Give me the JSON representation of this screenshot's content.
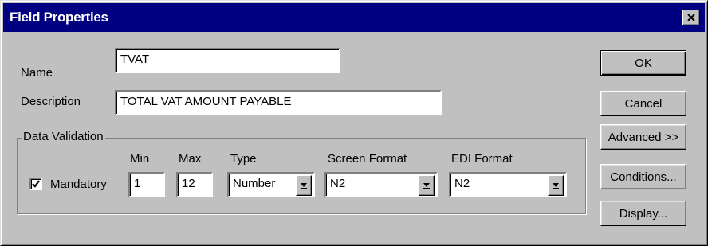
{
  "window": {
    "title": "Field Properties",
    "close_label": "×"
  },
  "form": {
    "name_label": "Name",
    "name_value": "TVAT",
    "description_label": "Description",
    "description_value": "TOTAL VAT AMOUNT PAYABLE"
  },
  "validation": {
    "group_label": "Data Validation",
    "mandatory_label": "Mandatory",
    "mandatory_checked": true,
    "min_label": "Min",
    "min_value": "1",
    "max_label": "Max",
    "max_value": "12",
    "type_label": "Type",
    "type_value": "Number",
    "screen_format_label": "Screen Format",
    "screen_format_value": "N2",
    "edi_format_label": "EDI Format",
    "edi_format_value": "N2"
  },
  "buttons": {
    "ok": "OK",
    "cancel": "Cancel",
    "advanced": "Advanced >>",
    "conditions": "Conditions...",
    "display": "Display..."
  },
  "icons": {
    "close": "close-icon",
    "dropdown": "dropdown-arrow-icon",
    "check": "check-icon"
  }
}
